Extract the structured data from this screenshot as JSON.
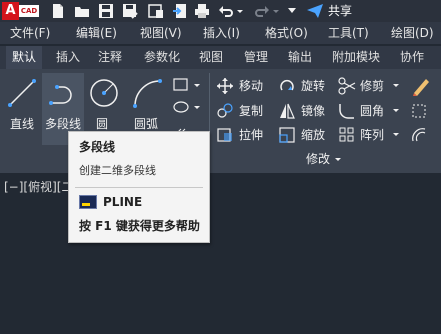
{
  "app": {
    "logo_letter": "A",
    "logo_text": "CAD",
    "share_label": "共享"
  },
  "menu": [
    "文件(F)",
    "编辑(E)",
    "视图(V)",
    "插入(I)",
    "格式(O)",
    "工具(T)",
    "绘图(D)"
  ],
  "tabs": [
    "默认",
    "插入",
    "注释",
    "参数化",
    "视图",
    "管理",
    "输出",
    "附加模块",
    "协作"
  ],
  "active_tab": "默认",
  "draw_tools": [
    {
      "label": "直线",
      "icon": "line-icon"
    },
    {
      "label": "多段线",
      "icon": "polyline-icon"
    },
    {
      "label": "圆",
      "icon": "circle-icon"
    },
    {
      "label": "圆弧",
      "icon": "arc-icon"
    }
  ],
  "modify_tools": [
    {
      "label": "移动",
      "icon": "move-icon"
    },
    {
      "label": "旋转",
      "icon": "rotate-icon"
    },
    {
      "label": "修剪",
      "icon": "trim-icon"
    },
    {
      "label": "复制",
      "icon": "copy-icon"
    },
    {
      "label": "镜像",
      "icon": "mirror-icon"
    },
    {
      "label": "圆角",
      "icon": "fillet-icon"
    },
    {
      "label": "拉伸",
      "icon": "stretch-icon"
    },
    {
      "label": "缩放",
      "icon": "scale-icon"
    },
    {
      "label": "阵列",
      "icon": "array-icon"
    }
  ],
  "modify_panel_title": "修改",
  "viewport_label": "[−][俯视][二",
  "tooltip": {
    "title": "多段线",
    "description": "创建二维多段线",
    "command": "PLINE",
    "help": "按 F1 键获得更多帮助"
  },
  "colors": {
    "background": "#222933",
    "ribbon": "#3b4350",
    "accent": "#d4141c",
    "tooltip": "#f4f4f4"
  }
}
